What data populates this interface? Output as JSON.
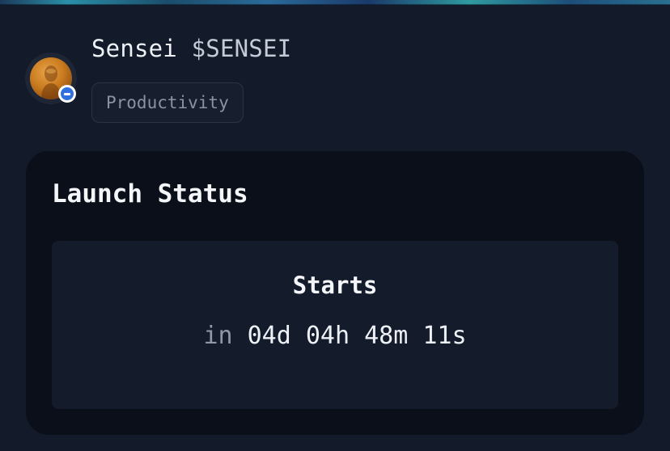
{
  "token": {
    "name": "Sensei",
    "symbol": "$SENSEI",
    "category": "Productivity",
    "avatar_icon": "sensei-avatar-icon",
    "chain_icon": "chain-badge-icon"
  },
  "launch": {
    "heading": "Launch Status",
    "status_label": "Starts",
    "countdown_prefix": "in",
    "countdown_value": "04d 04h 48m 11s"
  },
  "colors": {
    "background": "#131a2a",
    "card": "#0a0f1a",
    "status_box": "#141b2b",
    "chain_badge": "#2f6fe0",
    "avatar": "#c97a1e"
  }
}
